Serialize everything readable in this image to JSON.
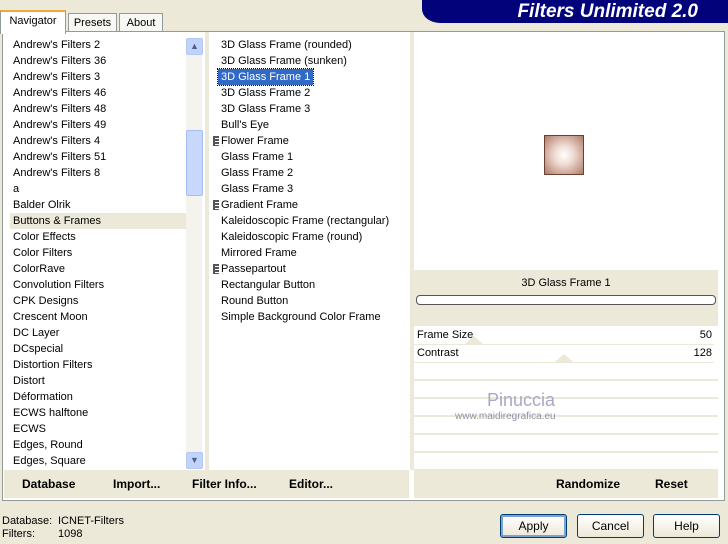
{
  "tabs": [
    "Navigator",
    "Presets",
    "About"
  ],
  "banner": "Filters Unlimited 2.0",
  "categories": [
    "Andrew's Filters 2",
    "Andrew's Filters 36",
    "Andrew's Filters 3",
    "Andrew's Filters 46",
    "Andrew's Filters 48",
    "Andrew's Filters 49",
    "Andrew's Filters 4",
    "Andrew's Filters 51",
    "Andrew's Filters 8",
    "a",
    "Balder Olrik",
    "Buttons & Frames",
    "Color Effects",
    "Color Filters",
    "ColorRave",
    "Convolution Filters",
    "CPK Designs",
    "Crescent Moon",
    "DC Layer",
    "DCspecial",
    "Distortion Filters",
    "Distort",
    "Déformation",
    "ECWS halftone",
    "ECWS",
    "Edges, Round",
    "Edges, Square"
  ],
  "selected_category": "Buttons & Frames",
  "filters": [
    {
      "label": "3D Glass Frame (rounded)"
    },
    {
      "label": "3D Glass Frame (sunken)"
    },
    {
      "label": "3D Glass Frame 1",
      "selected": true
    },
    {
      "label": "3D Glass Frame 2"
    },
    {
      "label": "3D Glass Frame 3"
    },
    {
      "label": "Bull's Eye"
    },
    {
      "label": "Flower Frame",
      "group": true
    },
    {
      "label": "Glass Frame 1"
    },
    {
      "label": "Glass Frame 2"
    },
    {
      "label": "Glass Frame 3"
    },
    {
      "label": "Gradient Frame",
      "group": true
    },
    {
      "label": "Kaleidoscopic Frame (rectangular)"
    },
    {
      "label": "Kaleidoscopic Frame (round)"
    },
    {
      "label": "Mirrored Frame"
    },
    {
      "label": "Passepartout",
      "group": true
    },
    {
      "label": "Rectangular Button"
    },
    {
      "label": "Round Button"
    },
    {
      "label": "Simple Background Color Frame"
    }
  ],
  "preview_title": "3D Glass Frame 1",
  "params": [
    {
      "name": "Frame Size",
      "value": "50",
      "fraction": 0.2
    },
    {
      "name": "Contrast",
      "value": "128",
      "fraction": 0.5
    }
  ],
  "watermark": {
    "name": "Pinuccia",
    "url": "www.maidiregrafica.eu"
  },
  "left_buttons": {
    "database": "Database",
    "import": "Import...",
    "filter_info": "Filter Info...",
    "editor": "Editor..."
  },
  "right_buttons": {
    "randomize": "Randomize",
    "reset": "Reset"
  },
  "status": {
    "database_label": "Database:",
    "database_value": "ICNET-Filters",
    "filters_label": "Filters:",
    "filters_value": "1098"
  },
  "dialog_buttons": {
    "apply": "Apply",
    "cancel": "Cancel",
    "help": "Help"
  }
}
